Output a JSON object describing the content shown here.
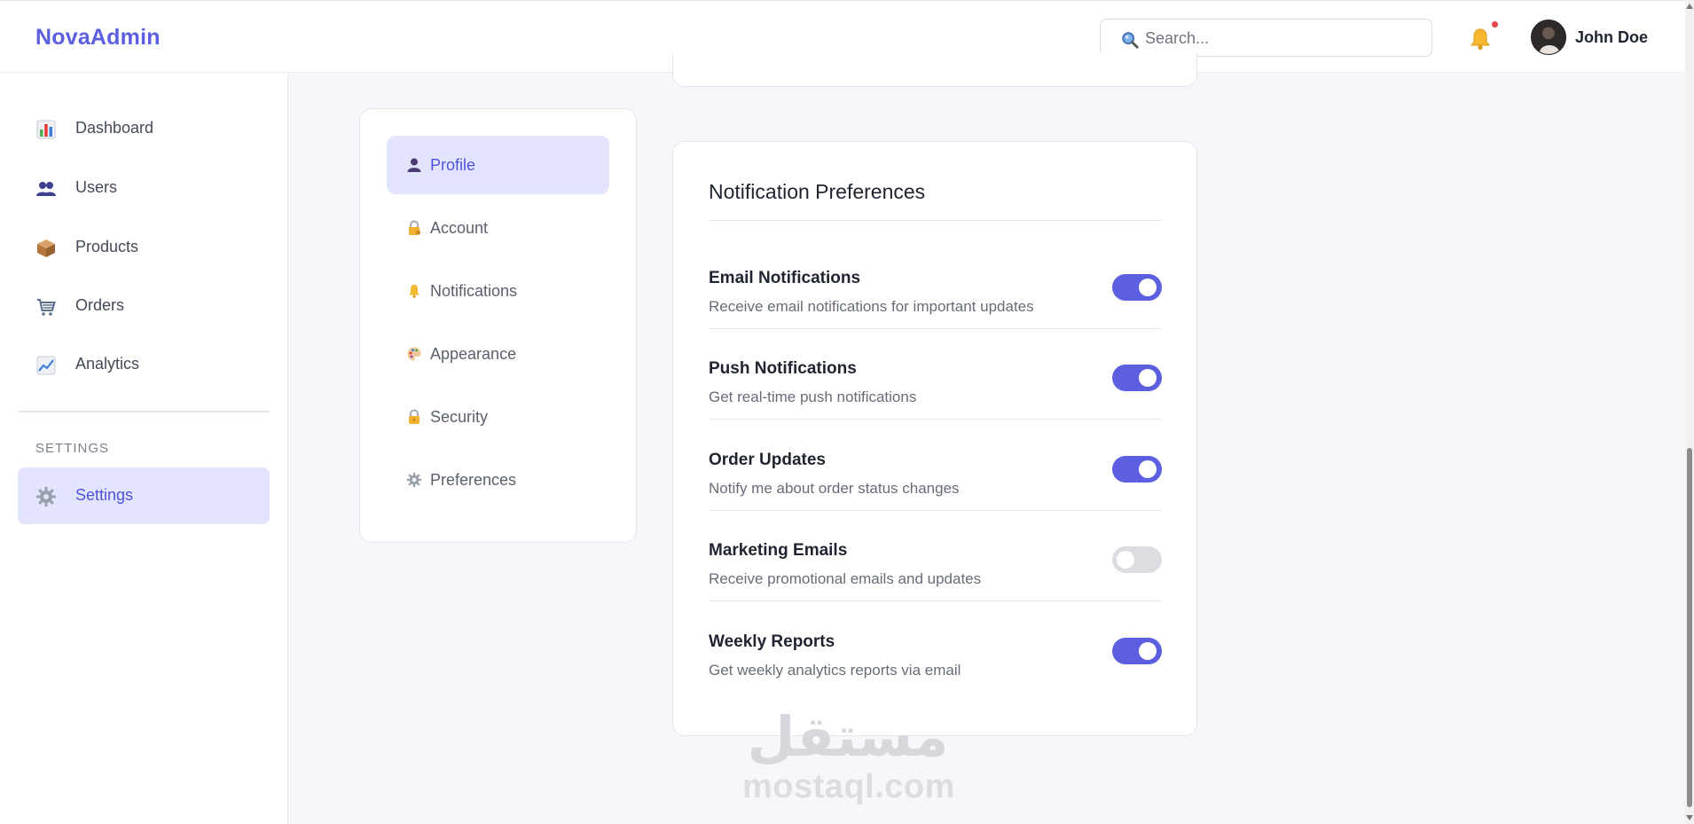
{
  "header": {
    "logo": "NovaAdmin",
    "search_placeholder": "Search...",
    "user_name": "John Doe",
    "notification_dot": true
  },
  "sidebar": {
    "items": [
      {
        "label": "Dashboard",
        "icon": "bar-chart-icon"
      },
      {
        "label": "Users",
        "icon": "users-icon"
      },
      {
        "label": "Products",
        "icon": "package-icon"
      },
      {
        "label": "Orders",
        "icon": "cart-icon"
      },
      {
        "label": "Analytics",
        "icon": "trend-chart-icon"
      }
    ],
    "section_label": "SETTINGS",
    "settings_item": {
      "label": "Settings",
      "icon": "gear-icon",
      "active": true
    }
  },
  "settings_menu": {
    "items": [
      {
        "label": "Profile",
        "icon": "person-icon",
        "active": true
      },
      {
        "label": "Account",
        "icon": "lock-key-icon"
      },
      {
        "label": "Notifications",
        "icon": "bell-icon"
      },
      {
        "label": "Appearance",
        "icon": "palette-icon"
      },
      {
        "label": "Security",
        "icon": "lock-icon"
      },
      {
        "label": "Preferences",
        "icon": "gear-icon"
      }
    ]
  },
  "notifications": {
    "title": "Notification Preferences",
    "prefs": [
      {
        "name": "Email Notifications",
        "desc": "Receive email notifications for important updates",
        "enabled": true
      },
      {
        "name": "Push Notifications",
        "desc": "Get real-time push notifications",
        "enabled": true
      },
      {
        "name": "Order Updates",
        "desc": "Notify me about order status changes",
        "enabled": true
      },
      {
        "name": "Marketing Emails",
        "desc": "Receive promotional emails and updates",
        "enabled": false
      },
      {
        "name": "Weekly Reports",
        "desc": "Get weekly analytics reports via email",
        "enabled": true
      }
    ]
  },
  "watermark": {
    "arabic": "مستقل",
    "latin": "mostaql.com"
  },
  "colors": {
    "accent": "#5b5fe0",
    "active_bg": "#e2e5fd",
    "toggle_off": "#dcdde2",
    "badge": "#e5484d"
  }
}
